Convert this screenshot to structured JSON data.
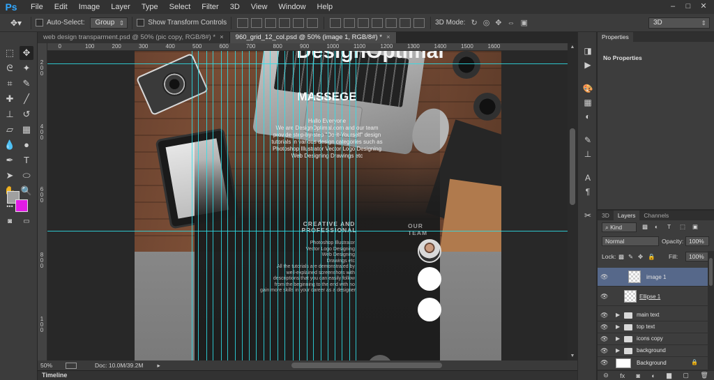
{
  "menu": {
    "logo": "Ps",
    "items": [
      "File",
      "Edit",
      "Image",
      "Layer",
      "Type",
      "Select",
      "Filter",
      "3D",
      "View",
      "Window",
      "Help"
    ]
  },
  "window_controls": [
    "–",
    "□",
    "✕"
  ],
  "options_bar": {
    "auto_select_label": "Auto-Select:",
    "auto_select_checked": false,
    "auto_select_target": "Group",
    "show_transform_label": "Show Transform Controls",
    "show_transform_checked": false,
    "mode_3d_label": "3D Mode:",
    "workspace": "3D"
  },
  "document_tabs": [
    {
      "title": "web design transparment.psd @ 50% (pic copy, RGB/8#) *",
      "active": false
    },
    {
      "title": "960_grid_12_col.psd @ 50% (image 1, RGB/8#) *",
      "active": true
    }
  ],
  "tab_close_glyph": "×",
  "ruler_top": [
    "300",
    "200",
    "100",
    "0",
    "100",
    "200",
    "300",
    "400",
    "500",
    "600",
    "700",
    "800",
    "900",
    "1000",
    "1100",
    "1200",
    "1300",
    "1400",
    "1500",
    "1600"
  ],
  "ruler_left": [
    "2",
    "0",
    "0",
    "4",
    "0",
    "0",
    "6",
    "0",
    "0",
    "8",
    "0",
    "0",
    "1",
    "0",
    "0",
    "0"
  ],
  "canvas": {
    "site_logo": "DesignOptimal",
    "title": "MASSEGE",
    "intro_lines": [
      "Hallo Everyone",
      "We are DesignOptimal.com and our team",
      "provide step-by-step \"Do-it-Yourself\" design",
      "tutorials in various design categories such as",
      "Photoshop Illustrator Vector Logo Designing",
      "Web Designing Drawings etc"
    ],
    "creative_heading_lines": [
      "CREATIVE AND",
      "PROFESSIONAL"
    ],
    "creative_lines": [
      "Photoshop Illustrator",
      "Vector Logo Designing",
      "Web Designing",
      "Drawings etc",
      "All the tutorials are demonstrated by",
      "well-explained screenshots with",
      "descriptions that you can easily follow",
      "from the beginning to the end with no",
      "gain more skills in your career as a designer"
    ],
    "team_heading": "OUR TEAM"
  },
  "status": {
    "zoom": "50%",
    "doc_info": "Doc: 10.0M/39.2M",
    "more_arrow": "▸",
    "timeline_label": "Timeline"
  },
  "properties_panel": {
    "tab": "Properties",
    "message": "No Properties"
  },
  "layers_panel": {
    "tabs": [
      "3D",
      "Layers",
      "Channels"
    ],
    "active_tab": "Layers",
    "filter_kind": "Kind",
    "blend_mode": "Normal",
    "opacity_label": "Opacity:",
    "opacity_value": "100%",
    "lock_label": "Lock:",
    "fill_label": "Fill:",
    "fill_value": "100%",
    "layers": [
      {
        "name": "image 1",
        "type": "smart",
        "selected": true,
        "visible": true
      },
      {
        "name": "Ellipse 1",
        "type": "shape",
        "selected": false,
        "visible": true
      },
      {
        "name": "main text",
        "type": "group",
        "selected": false,
        "visible": true
      },
      {
        "name": "top text",
        "type": "group",
        "selected": false,
        "visible": true
      },
      {
        "name": "icons copy",
        "type": "group",
        "selected": false,
        "visible": true
      },
      {
        "name": "background",
        "type": "group",
        "selected": false,
        "visible": true
      },
      {
        "name": "Background",
        "type": "background",
        "selected": false,
        "visible": true,
        "locked": true
      }
    ],
    "footer_icons": [
      "link-icon",
      "fx-icon",
      "mask-icon",
      "adjustment-icon",
      "folder-icon",
      "new-layer-icon",
      "trash-icon"
    ],
    "footer_glyphs": [
      "⊝",
      "fx",
      "◙",
      "◐",
      "▆",
      "▢",
      "🗑"
    ]
  },
  "colors": {
    "foreground_color": "#a0a0a0",
    "background_color": "#e21be6",
    "guide_color": "#2ee1ea",
    "selection_color": "#56688a"
  }
}
